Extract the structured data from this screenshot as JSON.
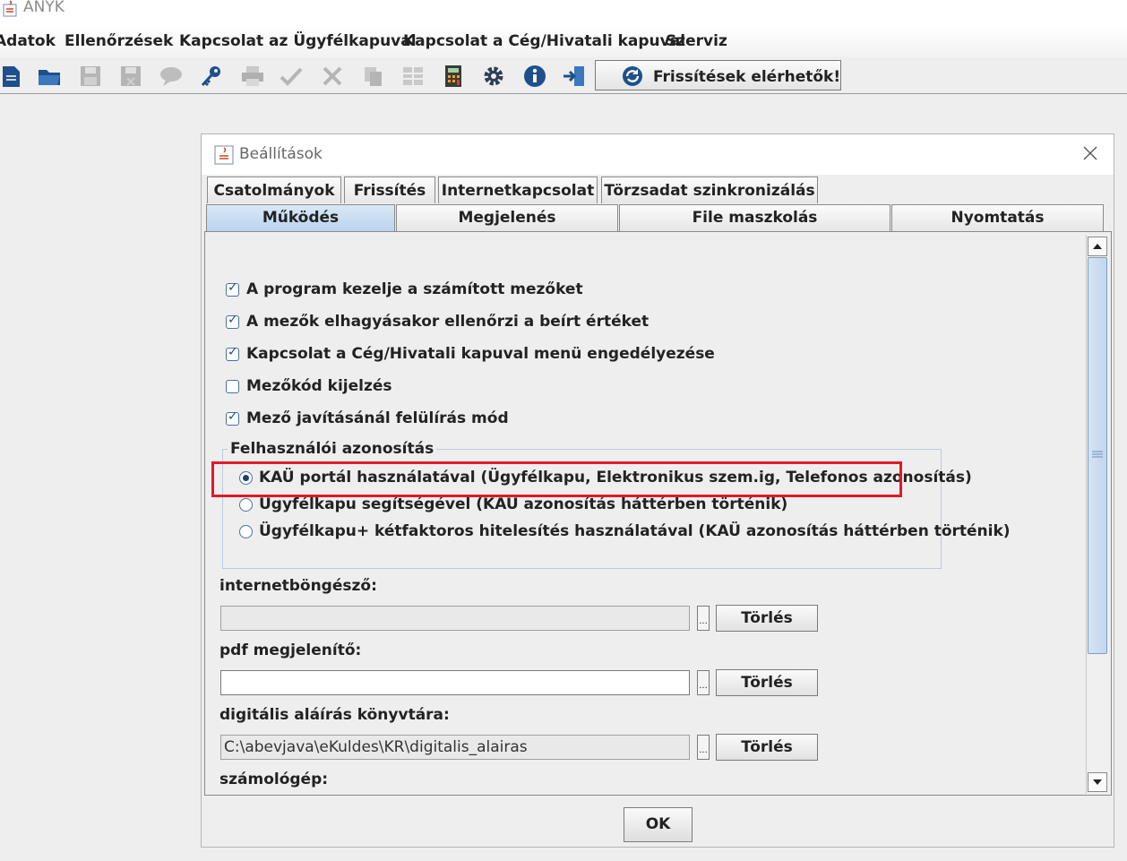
{
  "app": {
    "title": "ANYK"
  },
  "menu": [
    "Adatok",
    "Ellenőrzések",
    "Kapcsolat az Ügyfélkapuval",
    "Kapcsolat a Cég/Hivatali kapuval",
    "Szerviz"
  ],
  "toolbar": {
    "icons": [
      "new-document-icon",
      "open-folder-icon",
      "save-icon",
      "save-as-icon",
      "comment-icon",
      "key-icon",
      "print-icon",
      "check-icon",
      "delete-icon",
      "copy-icon",
      "grid-icon",
      "calculator-icon",
      "gear-icon",
      "info-icon",
      "exit-icon"
    ],
    "update_label": "Frissítések elérhetők!"
  },
  "dialog": {
    "title": "Beállítások",
    "tabs_row1": [
      "Csatolmányok",
      "Frissítés",
      "Internetkapcsolat",
      "Törzsadat szinkronizálás"
    ],
    "tabs_row2": [
      "Működés",
      "Megjelenés",
      "File maszkolás",
      "Nyomtatás"
    ],
    "selected_tab": "Működés",
    "options": [
      {
        "label": "A program kezelje a számított mezőket",
        "checked": true
      },
      {
        "label": "A mezők elhagyásakor ellenőrzi a beírt értéket",
        "checked": true
      },
      {
        "label": "Kapcsolat a Cég/Hivatali kapuval menü engedélyezése",
        "checked": true
      },
      {
        "label": "Mezőkód kijelzés",
        "checked": false
      },
      {
        "label": "Mező javításánál felülírás mód",
        "checked": true
      }
    ],
    "auth_group": {
      "title": "Felhasználói azonosítás",
      "options": [
        {
          "label": "KAÜ portál használatával (Ügyfélkapu, Elektronikus szem.ig, Telefonos azonosítás)",
          "selected": true
        },
        {
          "label": "Ügyfélkapu segítségével (KAÜ azonosítás háttérben történik)",
          "selected": false
        },
        {
          "label": "Ügyfélkapu+ kétfaktoros hitelesítés használatával (KAÜ azonosítás háttérben történik)",
          "selected": false
        }
      ]
    },
    "fields": {
      "browser_label": "internetböngésző:",
      "browser_value": "",
      "pdf_label": "pdf megjelenítő:",
      "pdf_value": "",
      "signature_label": "digitális aláírás könyvtára:",
      "signature_value": "C:\\abevjava\\eKuldes\\KR\\digitalis_alairas",
      "calculator_label": "számológép:",
      "browse_label": "...",
      "delete_label": "Törlés"
    },
    "ok_label": "OK",
    "highlight_color": "#e01b24"
  }
}
